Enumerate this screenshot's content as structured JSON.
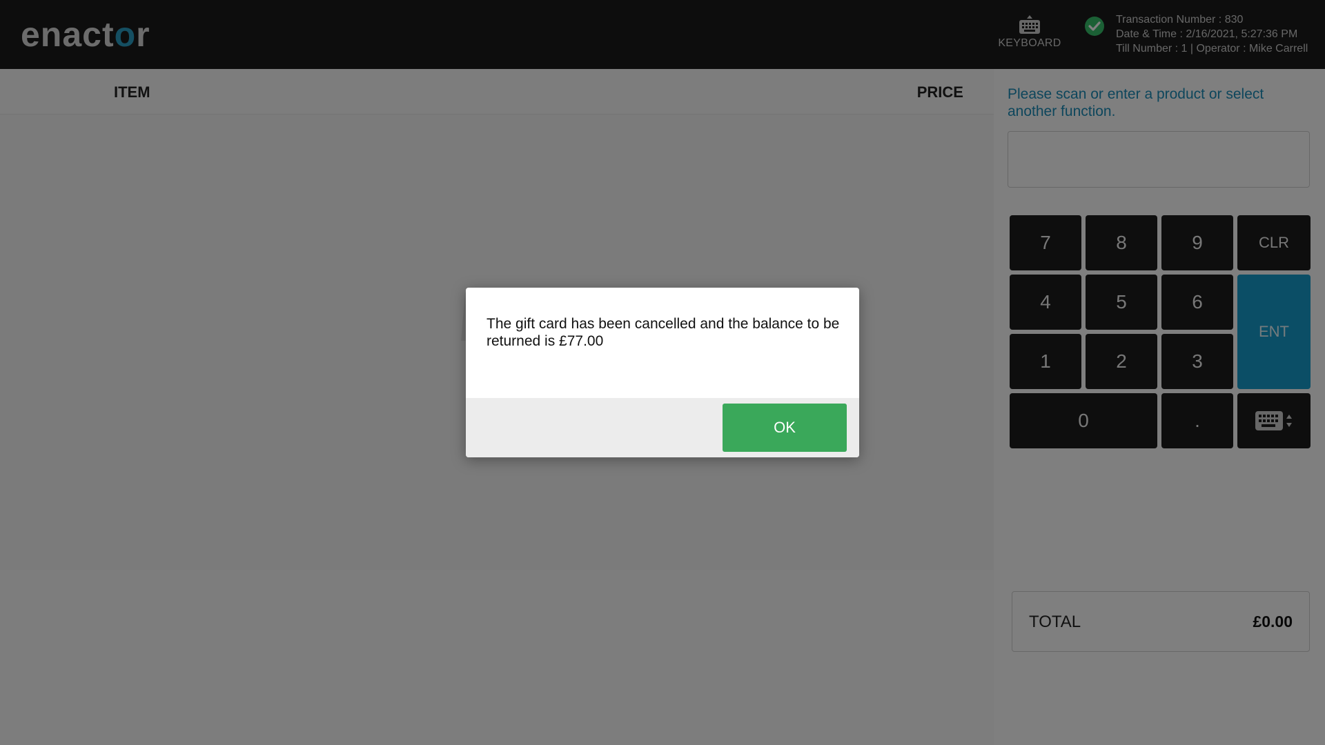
{
  "header": {
    "logo_prefix": "enact",
    "logo_o": "o",
    "logo_suffix": "r",
    "keyboard_label": "KEYBOARD",
    "keyboard_icon": "keyboard-icon",
    "status_icon": "check-circle-icon",
    "status_color": "#37c06b",
    "transaction": "Transaction Number : 830",
    "datetime": "Date & Time : 2/16/2021, 5:27:36 PM",
    "till": "Till Number : 1 | Operator : Mike Carrell"
  },
  "item_list": {
    "col_item": "ITEM",
    "col_price": "PRICE",
    "empty_icon": "basket-icon"
  },
  "input": {
    "prompt": "Please scan or enter a product or select another function.",
    "value": ""
  },
  "keypad": {
    "k7": "7",
    "k8": "8",
    "k9": "9",
    "clr": "CLR",
    "k4": "4",
    "k5": "5",
    "k6": "6",
    "ent": "ENT",
    "k1": "1",
    "k2": "2",
    "k3": "3",
    "k0": "0",
    "dot": ".",
    "toggle_icon": "keyboard-toggle-icon"
  },
  "total": {
    "label": "TOTAL",
    "value": "£0.00"
  },
  "dialog": {
    "message": "The gift card has been cancelled and the balance to be returned is £77.00",
    "ok_label": "OK"
  },
  "colors": {
    "accent_blue": "#179dcc",
    "ok_green": "#3aa85a",
    "header_bg": "#1a1a1a"
  }
}
